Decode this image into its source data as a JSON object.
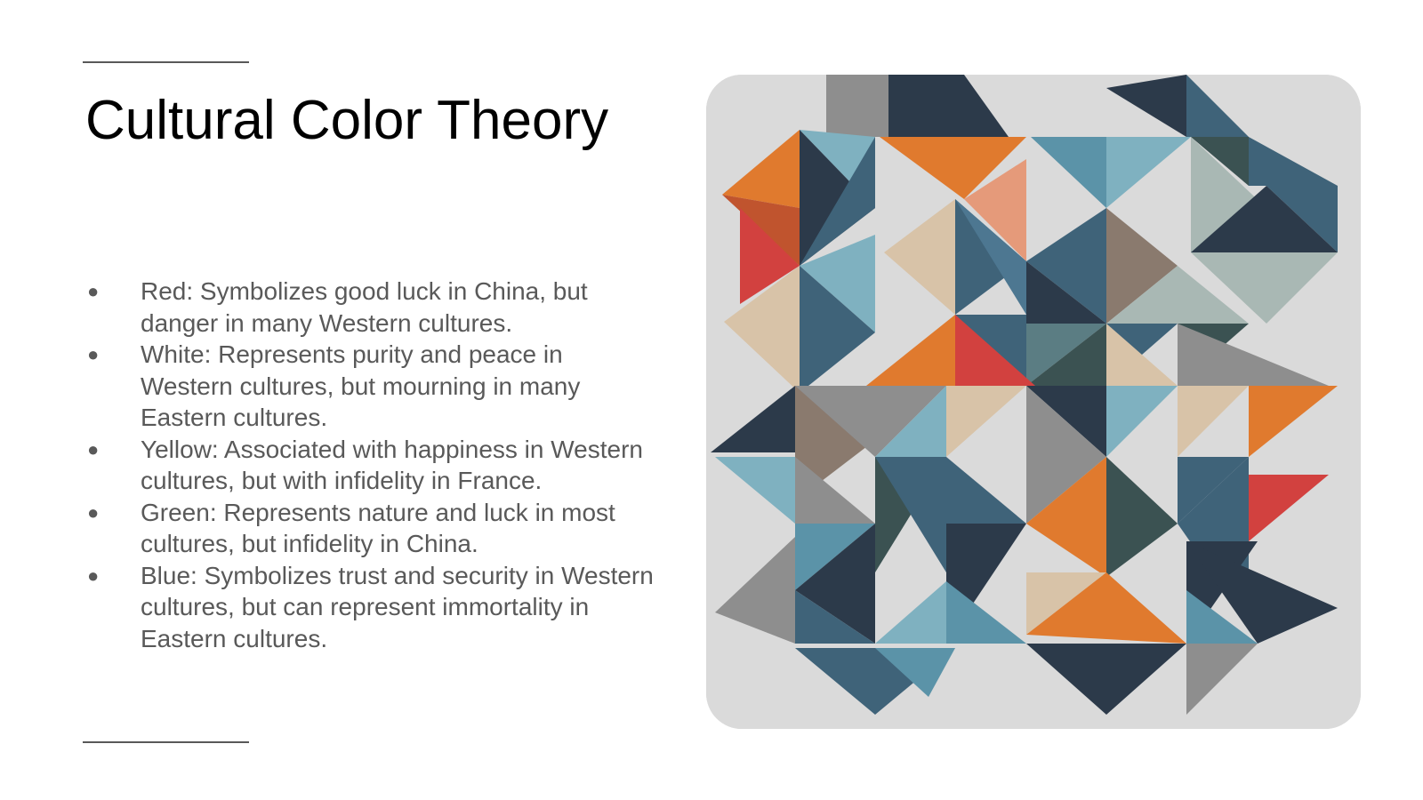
{
  "slide": {
    "title": "Cultural Color Theory",
    "bullets": [
      "Red: Symbolizes good luck in China, but danger in many Western cultures.",
      "White: Represents purity and peace in Western cultures, but mourning in many Eastern cultures.",
      "Yellow: Associated with happiness in Western cultures, but with infidelity in France.",
      "Green: Represents nature and luck in most cultures, but infidelity in China.",
      "Blue: Symbolizes trust and security in Western cultures, but can represent immortality in Eastern cultures."
    ],
    "bullet_glyph": "●"
  },
  "image": {
    "subject": "fabric triangles quilt mosaic",
    "palette": {
      "background": "#dadada",
      "navy": "#2c3a4a",
      "slate_blue": "#3f6379",
      "teal": "#5b93a8",
      "light_teal": "#7fb1c0",
      "orange": "#e07a2e",
      "red": "#d2413f",
      "salmon": "#e59a7a",
      "beige": "#d8c3a8",
      "taupe": "#8a7a6e",
      "gray": "#8e8e8e",
      "sage": "#a9b8b4",
      "dark_green": "#3b5252"
    }
  }
}
